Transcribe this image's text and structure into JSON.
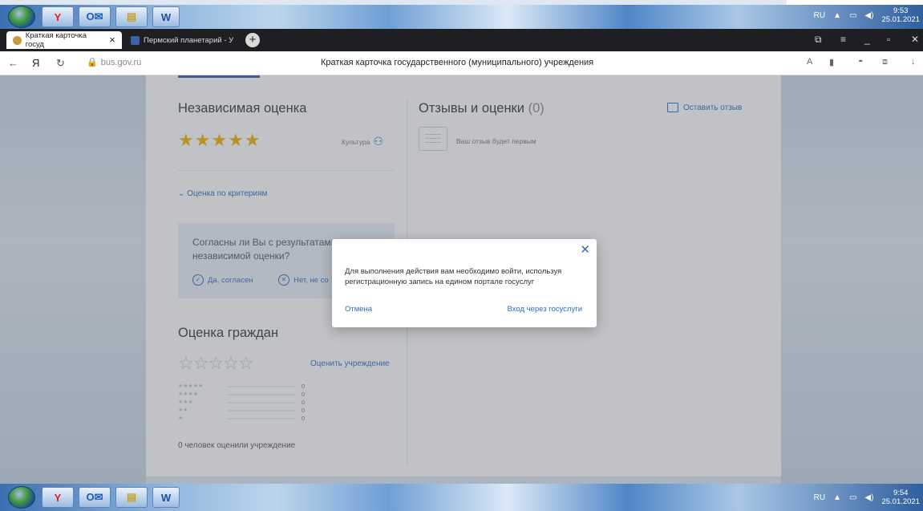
{
  "taskbar_top": {
    "language": "RU",
    "time": "9:53",
    "date": "25.01.2021",
    "apps": [
      "start-orb-icon",
      "yandex-browser-icon",
      "outlook-icon",
      "file-explorer-icon",
      "word-icon"
    ]
  },
  "taskbar_bottom": {
    "language": "RU",
    "time": "9:54",
    "date": "25.01.2021"
  },
  "browser": {
    "tabs": [
      {
        "label": "Краткая карточка госуд",
        "active": true
      },
      {
        "label": "Пермский планетарий - У",
        "active": false
      }
    ],
    "new_tab": "+",
    "address": {
      "host": "bus.gov.ru",
      "page_title": "Краткая карточка государственного (муниципального) учреждения"
    }
  },
  "page": {
    "independent": {
      "title": "Независимая оценка",
      "stars": "★★★★★",
      "category": "Культура",
      "criteria_link": "Оценка по критериям"
    },
    "agree_box": {
      "question": "Согласны ли Вы с результатами независимой оценки?",
      "yes": "Да, согласен",
      "no": "Нет, не со"
    },
    "citizens": {
      "title": "Оценка граждан",
      "empty_stars": "☆☆☆☆☆",
      "rate_link": "Оценить учреждение",
      "rows": [
        {
          "stars": "★★★★★",
          "count": "0"
        },
        {
          "stars": "★★★★",
          "count": "0"
        },
        {
          "stars": "★★★",
          "count": "0"
        },
        {
          "stars": "★★",
          "count": "0"
        },
        {
          "stars": "★",
          "count": "0"
        }
      ],
      "rated_text": "0 человек оценили учреждение"
    },
    "reviews": {
      "title": "Отзывы и оценки",
      "count": "(0)",
      "leave_link": "Оставить отзыв",
      "first_text": "Ваш отзыв будет первым"
    }
  },
  "modal": {
    "close": "✕",
    "message": "Для выполнения действия вам необходимо войти, используя регистрационную запись на едином портале госуслуг",
    "cancel": "Отмена",
    "login": "Вход через госуслуги"
  },
  "colors": {
    "accent": "#2f6cc0",
    "gold_star": "#f0b400"
  }
}
